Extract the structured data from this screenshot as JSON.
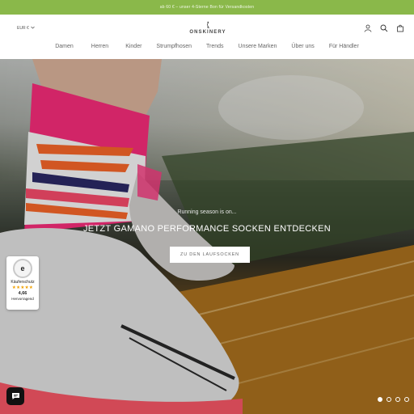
{
  "announcement": {
    "text": "ab 60 € – unser 4-Sterne Bon für Versandkosten"
  },
  "header": {
    "currency": "EUR €",
    "logo": "ONSKINERY",
    "icons": [
      "account-icon",
      "search-icon",
      "cart-icon"
    ]
  },
  "nav": {
    "items": [
      {
        "label": "Damen"
      },
      {
        "label": "Herren"
      },
      {
        "label": "Kinder"
      },
      {
        "label": "Strumpfhosen"
      },
      {
        "label": "Trends"
      },
      {
        "label": "Unsere Marken"
      },
      {
        "label": "Über uns"
      },
      {
        "label": "Für Händler"
      }
    ]
  },
  "hero": {
    "kicker": "Running season is on...",
    "headline": "JETZT GAMANO PERFORMANCE SOCKEN ENTDECKEN",
    "cta": "ZU DEN LAUFSOCKEN",
    "slide_count": 4,
    "active_slide": 1
  },
  "trust_badge": {
    "seal": "e",
    "label": "Käuferschutz",
    "stars": "★★★★★",
    "score": "4,66",
    "rating": "Hervorragend"
  },
  "colors": {
    "announcement_bg": "#8ab84a",
    "sock_pink": "#ff2e7e",
    "sock_orange": "#ff6a2a",
    "track": "#a66d22"
  }
}
